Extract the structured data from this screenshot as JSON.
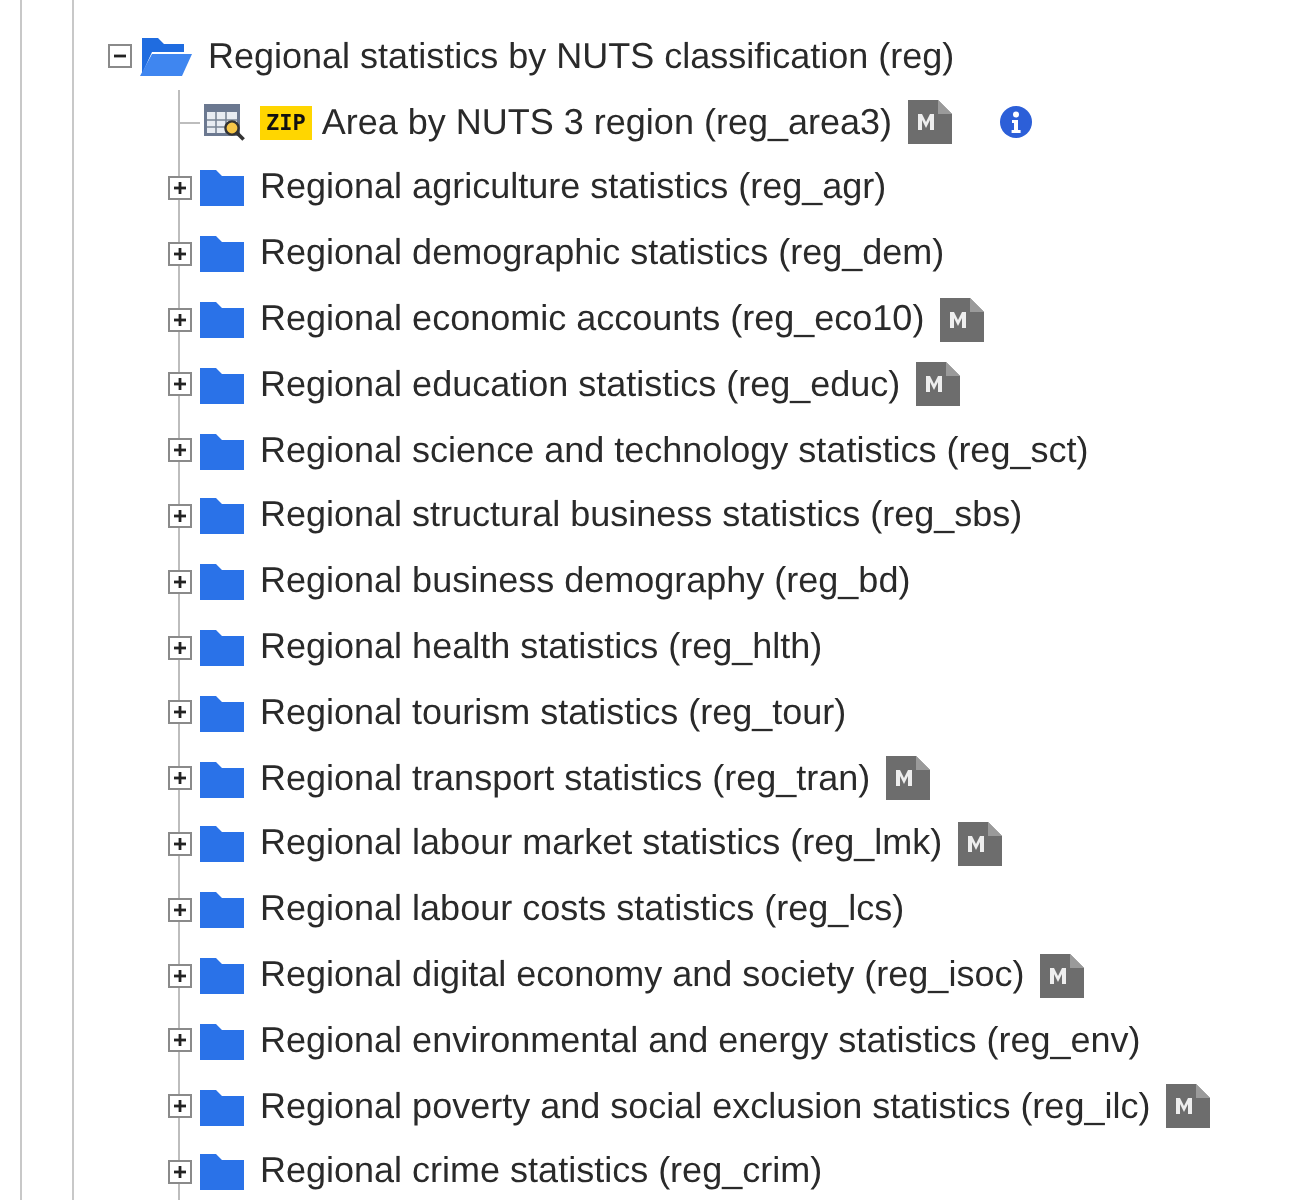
{
  "tree": {
    "label": "Regional statistics by NUTS classification (reg)",
    "expanded": true,
    "children": [
      {
        "kind": "dataset",
        "label": "Area by NUTS 3 region (reg_area3)",
        "badge": "ZIP",
        "metadata": true,
        "info": true
      },
      {
        "kind": "folder",
        "label": "Regional agriculture statistics (reg_agr)",
        "expanded": false,
        "metadata": false
      },
      {
        "kind": "folder",
        "label": "Regional demographic statistics (reg_dem)",
        "expanded": false,
        "metadata": false
      },
      {
        "kind": "folder",
        "label": "Regional economic accounts (reg_eco10)",
        "expanded": false,
        "metadata": true
      },
      {
        "kind": "folder",
        "label": "Regional education statistics (reg_educ)",
        "expanded": false,
        "metadata": true
      },
      {
        "kind": "folder",
        "label": "Regional science and technology statistics (reg_sct)",
        "expanded": false,
        "metadata": false
      },
      {
        "kind": "folder",
        "label": "Regional structural business statistics (reg_sbs)",
        "expanded": false,
        "metadata": false
      },
      {
        "kind": "folder",
        "label": "Regional business demography (reg_bd)",
        "expanded": false,
        "metadata": false
      },
      {
        "kind": "folder",
        "label": "Regional health statistics (reg_hlth)",
        "expanded": false,
        "metadata": false
      },
      {
        "kind": "folder",
        "label": "Regional tourism statistics (reg_tour)",
        "expanded": false,
        "metadata": false
      },
      {
        "kind": "folder",
        "label": "Regional transport statistics (reg_tran)",
        "expanded": false,
        "metadata": true
      },
      {
        "kind": "folder",
        "label": "Regional labour market statistics (reg_lmk)",
        "expanded": false,
        "metadata": true
      },
      {
        "kind": "folder",
        "label": "Regional labour costs statistics (reg_lcs)",
        "expanded": false,
        "metadata": false
      },
      {
        "kind": "folder",
        "label": "Regional digital economy and society (reg_isoc)",
        "expanded": false,
        "metadata": true
      },
      {
        "kind": "folder",
        "label": "Regional environmental and energy statistics (reg_env)",
        "expanded": false,
        "metadata": false
      },
      {
        "kind": "folder",
        "label": "Regional poverty and social exclusion statistics (reg_ilc)",
        "expanded": false,
        "metadata": true
      },
      {
        "kind": "folder",
        "label": "Regional crime statistics (reg_crim)",
        "expanded": false,
        "metadata": false
      }
    ]
  }
}
